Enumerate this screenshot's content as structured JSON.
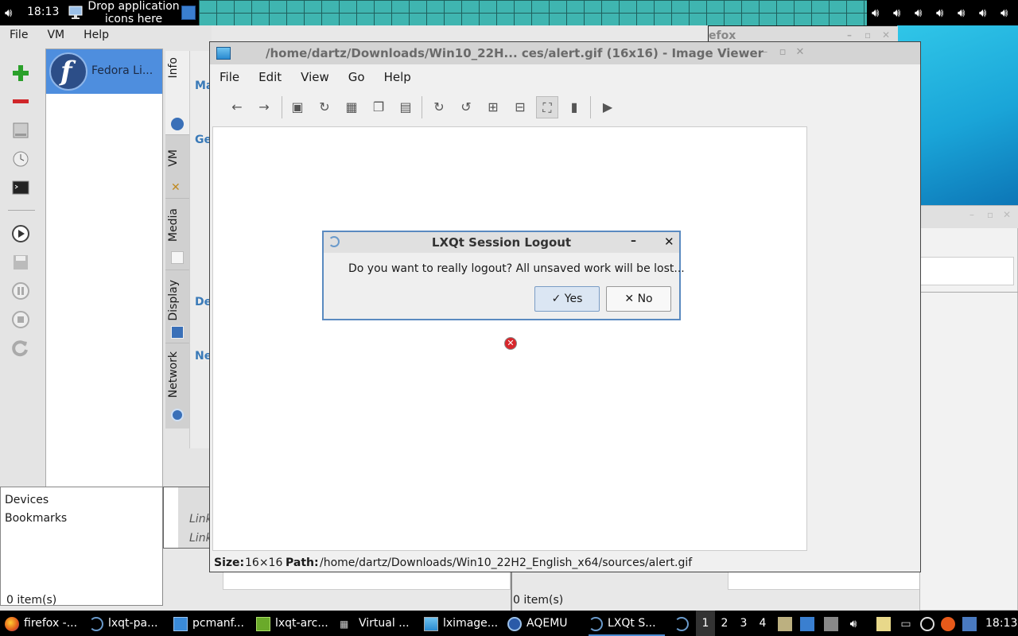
{
  "top_panel": {
    "clock": "18:13",
    "drop_text_line1": "Drop application",
    "drop_text_line2": "icons here"
  },
  "vm_manager": {
    "menu": [
      "File",
      "VM",
      "Help"
    ],
    "vm_name": "Fedora Li...",
    "tabs": [
      "Info",
      "VM",
      "Media",
      "Display",
      "Network"
    ],
    "detail_headings": [
      "Ma",
      "Ge",
      "De",
      "Ne"
    ]
  },
  "file_manager": {
    "sidebar": [
      "Devices",
      "Bookmarks"
    ],
    "links": [
      "Link",
      "Link"
    ],
    "status_left": "0 item(s)",
    "status_mid": "0 item(s)"
  },
  "firefox_back": {
    "title": "efox"
  },
  "image_viewer": {
    "title": "/home/dartz/Downloads/Win10_22H... ces/alert.gif (16x16) - Image Viewer",
    "menu": [
      "File",
      "Edit",
      "View",
      "Go",
      "Help"
    ],
    "status_size_label": "Size:",
    "status_size": "16×16",
    "status_path_label": "Path:",
    "status_path": "/home/dartz/Downloads/Win10_22H2_English_x64/sources/alert.gif"
  },
  "logout_dialog": {
    "title": "LXQt Session Logout",
    "message": "Do you want to really logout? All unsaved work will be lost...",
    "yes_label": "Yes",
    "no_label": "No"
  },
  "taskbar": {
    "tasks": [
      "firefox -...",
      "lxqt-pa...",
      "pcmanf...",
      "lxqt-arc...",
      "Virtual ...",
      "lximage...",
      "AQEMU",
      "LXQt S..."
    ],
    "desktops": [
      "1",
      "2",
      "3",
      "4"
    ],
    "clock": "18:13"
  },
  "colors": {
    "accent": "#4e8ede",
    "dialog_border": "#5a8ac0",
    "firefox_red": "#c0281a"
  }
}
